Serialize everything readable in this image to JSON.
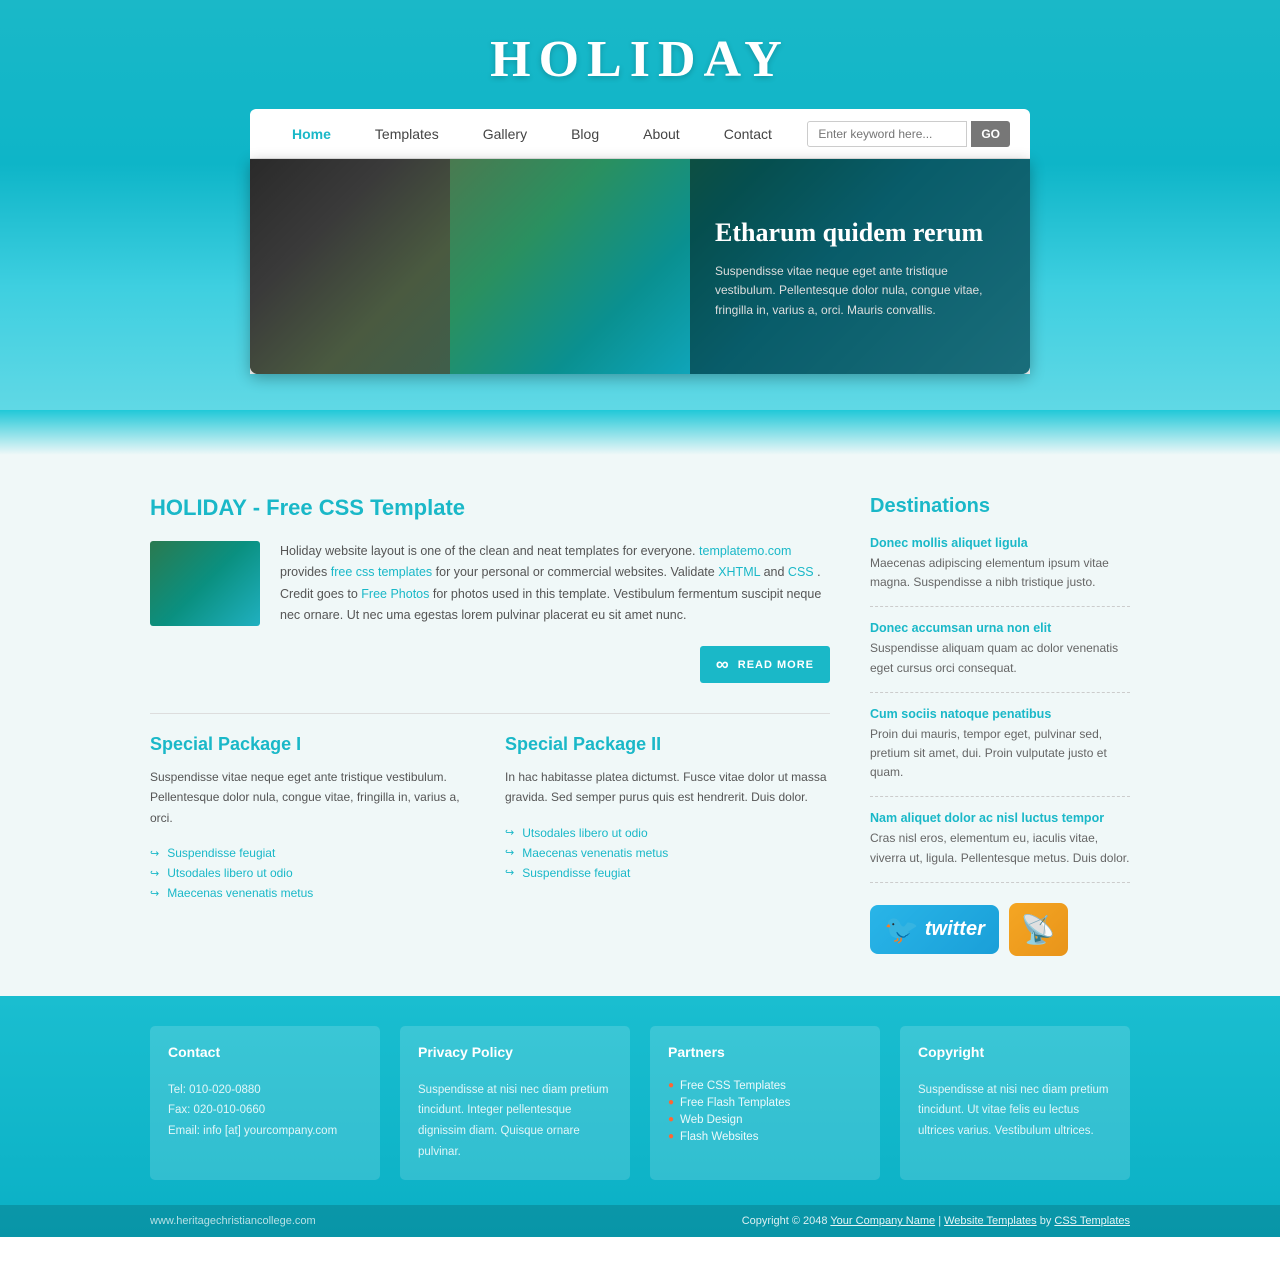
{
  "site": {
    "title": "HOLIDAY",
    "reflection": "—"
  },
  "nav": {
    "links": [
      {
        "label": "Home",
        "active": true
      },
      {
        "label": "Templates",
        "active": false
      },
      {
        "label": "Gallery",
        "active": false
      },
      {
        "label": "Blog",
        "active": false
      },
      {
        "label": "About",
        "active": false
      },
      {
        "label": "Contact",
        "active": false
      }
    ],
    "search_placeholder": "Enter keyword here...",
    "search_button": "GO"
  },
  "hero": {
    "title": "Etharum quidem rerum",
    "text": "Suspendisse vitae neque eget ante tristique vestibulum. Pellentesque dolor nula, congue vitae, fringilla in, varius a, orci. Mauris convallis."
  },
  "main": {
    "section_title": "HOLIDAY - Free CSS Template",
    "about_text_1": "Holiday website layout is one of the clean and neat templates for everyone.",
    "about_link_1": "templatemo.com",
    "about_text_2": " provides ",
    "about_link_2": "free css templates",
    "about_text_3": " for your personal or commercial websites. Validate ",
    "about_link_3": "XHTML",
    "about_text_4": " and ",
    "about_link_4": "CSS",
    "about_text_5": ". Credit goes to ",
    "about_link_5": "Free Photos",
    "about_text_6": " for photos used in this template. Vestibulum fermentum suscipit neque nec ornare. Ut nec uma egestas lorem pulvinar placerat eu sit amet nunc.",
    "read_more": "READ MORE",
    "packages": [
      {
        "title": "Special Package I",
        "text": "Suspendisse vitae neque eget ante tristique vestibulum. Pellentesque dolor nula, congue vitae, fringilla in, varius a, orci.",
        "items": [
          "Suspendisse feugiat",
          "Utsodales libero ut odio",
          "Maecenas venenatis metus"
        ]
      },
      {
        "title": "Special Package II",
        "text": "In hac habitasse platea dictumst. Fusce vitae dolor ut massa gravida. Sed semper purus quis est hendrerit. Duis dolor.",
        "items": [
          "Utsodales libero ut odio",
          "Maecenas venenatis metus",
          "Suspendisse feugiat"
        ]
      }
    ]
  },
  "sidebar": {
    "title": "Destinations",
    "items": [
      {
        "link": "Donec mollis aliquet ligula",
        "desc": "Maecenas adipiscing elementum ipsum vitae magna. Suspendisse a nibh tristique justo."
      },
      {
        "link": "Donec accumsan urna non elit",
        "desc": "Suspendisse aliquam quam ac dolor venenatis eget cursus orci consequat."
      },
      {
        "link": "Cum sociis natoque penatibus",
        "desc": "Proin dui mauris, tempor eget, pulvinar sed, pretium sit amet, dui. Proin vulputate justo et quam."
      },
      {
        "link": "Nam aliquet dolor ac nisl luctus tempor",
        "desc": "Cras nisl eros, elementum eu, iaculis vitae, viverra ut, ligula. Pellentesque metus. Duis dolor."
      }
    ]
  },
  "footer": {
    "columns": [
      {
        "title": "Contact",
        "lines": [
          "Tel: 010-020-0880",
          "Fax: 020-010-0660",
          "Email: info [at] yourcompany.com"
        ]
      },
      {
        "title": "Privacy Policy",
        "text": "Suspendisse at nisi nec diam pretium tincidunt. Integer pellentesque dignissim diam. Quisque ornare pulvinar."
      },
      {
        "title": "Partners",
        "links": [
          "Free CSS Templates",
          "Free Flash Templates",
          "Web Design",
          "Flash Websites"
        ]
      },
      {
        "title": "Copyright",
        "text": "Suspendisse at nisi nec diam pretium tincidunt. Ut vitae felis eu lectus ultrices varius. Vestibulum ultrices."
      }
    ],
    "bottom_left": "www.heritagechristiancollege.com",
    "bottom_right_pre": "Copyright © 2048 ",
    "bottom_company": "Your Company Name",
    "bottom_sep": " | ",
    "bottom_templates": "Website Templates",
    "bottom_by": " by ",
    "bottom_css": "CSS Templates"
  }
}
